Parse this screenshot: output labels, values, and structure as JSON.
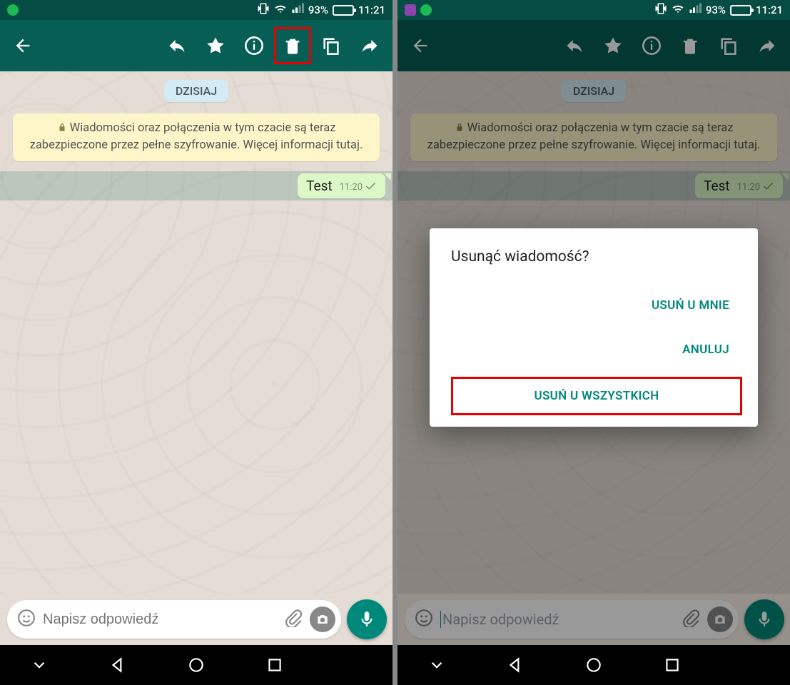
{
  "status": {
    "battery_pct": "93%",
    "time": "11:21"
  },
  "chat": {
    "date_label": "DZISIAJ",
    "encryption_notice": "Wiadomości oraz połączenia w tym czacie są teraz zabezpieczone przez pełne szyfrowanie. Więcej informacji tutaj.",
    "message": {
      "text": "Test",
      "time": "11:20"
    }
  },
  "composer": {
    "placeholder": "Napisz odpowiedź"
  },
  "dialog": {
    "title": "Usunąć wiadomość?",
    "delete_for_me": "USUŃ U MNIE",
    "cancel": "ANULUJ",
    "delete_for_all": "USUŃ U WSZYSTKICH"
  }
}
